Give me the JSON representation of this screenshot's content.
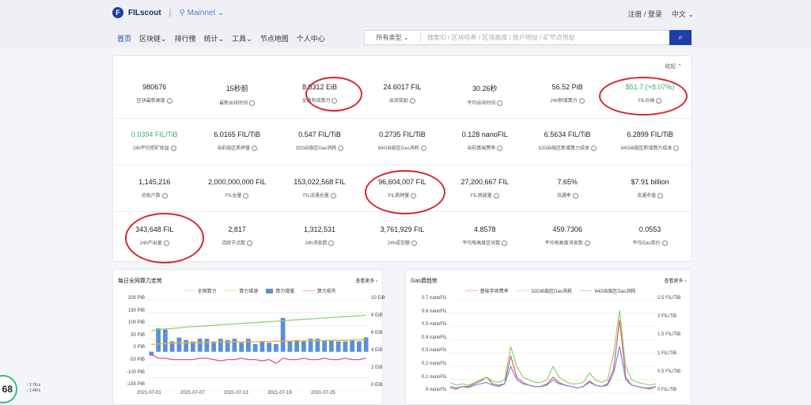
{
  "header": {
    "logo": "F",
    "brand": "FILscout",
    "separator": "|",
    "network": "Mainnet",
    "login": "注册 / 登录",
    "lang": "中文"
  },
  "nav": {
    "items": [
      "首页",
      "区块链",
      "排行榜",
      "统计",
      "工具",
      "节点地图",
      "个人中心"
    ]
  },
  "search": {
    "type": "所有类型",
    "placeholder": "搜索ID / 区块哈希 / 区块高度 / 账户地址 / 矿节点地址",
    "icon": "search-icon"
  },
  "stats": {
    "collapse": "收起",
    "rows": [
      [
        {
          "v": "980676",
          "l": "区块最新高度"
        },
        {
          "v": "15秒前",
          "l": "最新出块时间"
        },
        {
          "v": "8.3312 EiB",
          "l": "全网有效算力"
        },
        {
          "v": "24.6017 FIL",
          "l": "出块奖励"
        },
        {
          "v": "30.26秒",
          "l": "平均出块时间"
        },
        {
          "v": "56.52 PiB",
          "l": "24h新增算力"
        },
        {
          "v": "$51.7 (+8.07%)",
          "l": "FIL价格",
          "g": true
        }
      ],
      [
        {
          "v": "0.0394 FIL/TiB",
          "l": "24h平均挖矿收益",
          "g": true
        },
        {
          "v": "6.0165 FIL/TiB",
          "l": "当前扇区质押量"
        },
        {
          "v": "0.547 FIL/TiB",
          "l": "32GiB扇区Gas消耗"
        },
        {
          "v": "0.2735 FIL/TiB",
          "l": "64GiB扇区Gas消耗"
        },
        {
          "v": "0.128 nanoFIL",
          "l": "当前基础费率"
        },
        {
          "v": "6.5634 FIL/TiB",
          "l": "32GiB扇区新增算力成本"
        },
        {
          "v": "6.2899 FIL/TiB",
          "l": "64GiB扇区新增算力成本"
        }
      ],
      [
        {
          "v": "1,145,216",
          "l": "总账户数"
        },
        {
          "v": "2,000,000,000 FIL",
          "l": "FIL总量"
        },
        {
          "v": "153,022,568 FIL",
          "l": "FIL流通总量"
        },
        {
          "v": "96,604,007 FIL",
          "l": "FIL质押量"
        },
        {
          "v": "27,200,667 FIL",
          "l": "FIL销毁量"
        },
        {
          "v": "7.65%",
          "l": "流通率"
        },
        {
          "v": "$7.91 billion",
          "l": "流通市值"
        }
      ],
      [
        {
          "v": "343,648 FIL",
          "l": "24h产出量"
        },
        {
          "v": "2,817",
          "l": "活跃节点数"
        },
        {
          "v": "1,312,531",
          "l": "24h消息数"
        },
        {
          "v": "3,761,929 FIL",
          "l": "24h成交额"
        },
        {
          "v": "4.8578",
          "l": "平均每高度区块数"
        },
        {
          "v": "459.7306",
          "l": "平均每高度消息数"
        },
        {
          "v": "0.0553",
          "l": "平均Gas单价"
        }
      ]
    ]
  },
  "left_panel": {
    "title": "每日全网算力走势",
    "more": "查看更多",
    "legend": [
      "全网算力",
      "算力增速",
      "算力增量",
      "算力损失"
    ],
    "yleft": [
      "200 PiB",
      "150 PiB",
      "100 PiB",
      "50 PiB",
      "0 PiB",
      "-50 PiB",
      "-100 PiB",
      "-150 PiB"
    ],
    "yright": [
      "10 EiB",
      "8 EiB",
      "6 EiB",
      "4 EiB",
      "2 EiB",
      "0 EiB"
    ],
    "xlabels": [
      "2021-07-01",
      "2021-07-07",
      "2021-07-13",
      "2021-07-19",
      "2021-07-25"
    ]
  },
  "right_panel": {
    "title": "Gas费趋势",
    "more": "查看更多",
    "legend": [
      "基础手续费率",
      "32GiB扇区Gas消耗",
      "64GiB扇区Gas消耗"
    ],
    "yleft": [
      "0.7 nanoFIL",
      "0.6 nanoFIL",
      "0.5 nanoFIL",
      "0.4 nanoFIL",
      "0.3 nanoFIL",
      "0.2 nanoFIL",
      "0.1 nanoFIL",
      "0 nanoFIL"
    ],
    "yright": [
      "2.5 FIL/TiB",
      "2 FIL/TiB",
      "1.5 FIL/TiB",
      "1 FIL/TiB",
      "0.5 FIL/TiB",
      "0 FIL/TiB"
    ]
  },
  "badge": {
    "value": "68",
    "up": "2.7K/s",
    "down": "1.4K/s"
  },
  "chart_data": [
    {
      "type": "bar",
      "title": "每日全网算力走势",
      "series": [
        {
          "name": "算力增量",
          "values": [
            -15,
            90,
            85,
            40,
            55,
            45,
            40,
            50,
            50,
            40,
            50,
            45,
            50,
            35,
            50,
            30,
            40,
            35,
            30,
            130,
            40,
            45,
            40,
            50,
            50,
            45,
            45,
            40,
            40,
            45,
            40,
            55
          ]
        },
        {
          "name": "全网算力",
          "values": [
            6.6,
            6.7,
            6.8,
            6.85,
            6.9,
            7.0,
            7.05,
            7.1,
            7.15,
            7.2,
            7.25,
            7.3,
            7.35,
            7.4,
            7.45,
            7.5,
            7.55,
            7.6,
            7.65,
            7.7,
            7.75,
            7.8,
            7.85,
            7.9,
            7.95,
            8.0,
            8.05,
            8.1,
            8.15,
            8.2,
            8.25,
            8.3
          ]
        },
        {
          "name": "算力增速",
          "values": [
            28,
            30,
            32,
            33,
            34,
            34,
            35,
            35,
            36,
            36,
            37,
            37,
            38,
            38,
            39,
            39,
            40,
            40,
            41,
            41,
            41,
            42,
            42,
            43,
            43,
            43,
            44,
            44,
            44,
            45,
            45,
            46
          ]
        },
        {
          "name": "算力损失",
          "values": [
            -10,
            -25,
            -25,
            -30,
            -30,
            -30,
            -30,
            -25,
            -25,
            -30,
            -35,
            -30,
            -30,
            -25,
            -30,
            -30,
            -35,
            -30,
            -45,
            -25,
            -30,
            -30,
            -25,
            -30,
            -30,
            -25,
            -30,
            -30,
            -25,
            -30,
            -30,
            -25
          ]
        }
      ]
    },
    {
      "type": "line",
      "title": "Gas费趋势",
      "series": [
        {
          "name": "基础手续费率",
          "values": [
            0.04,
            0.03,
            0.05,
            0.05,
            0.07,
            0.09,
            0.12,
            0.07,
            0.06,
            0.07,
            0.28,
            0.12,
            0.08,
            0.06,
            0.05,
            0.05,
            0.07,
            0.12,
            0.08,
            0.06,
            0.05,
            0.04,
            0.05,
            0.09,
            0.06,
            0.05,
            0.07,
            0.18,
            0.55,
            0.12,
            0.06,
            0.05,
            0.04,
            0.03,
            0.05
          ]
        },
        {
          "name": "32GiB扇区Gas消耗",
          "values": [
            0.08,
            0.06,
            0.07,
            0.06,
            0.08,
            0.1,
            0.12,
            0.09,
            0.08,
            0.1,
            0.35,
            0.2,
            0.12,
            0.1,
            0.08,
            0.08,
            0.1,
            0.2,
            0.12,
            0.09,
            0.07,
            0.07,
            0.08,
            0.15,
            0.1,
            0.08,
            0.1,
            0.3,
            0.62,
            0.2,
            0.1,
            0.08,
            0.07,
            0.06,
            0.07
          ]
        },
        {
          "name": "64GiB扇区Gas消耗",
          "values": [
            0.05,
            0.04,
            0.05,
            0.04,
            0.06,
            0.07,
            0.08,
            0.06,
            0.05,
            0.07,
            0.2,
            0.1,
            0.07,
            0.06,
            0.05,
            0.05,
            0.06,
            0.1,
            0.07,
            0.06,
            0.05,
            0.04,
            0.05,
            0.08,
            0.06,
            0.05,
            0.06,
            0.15,
            0.35,
            0.1,
            0.06,
            0.05,
            0.04,
            0.04,
            0.05
          ]
        }
      ]
    }
  ]
}
